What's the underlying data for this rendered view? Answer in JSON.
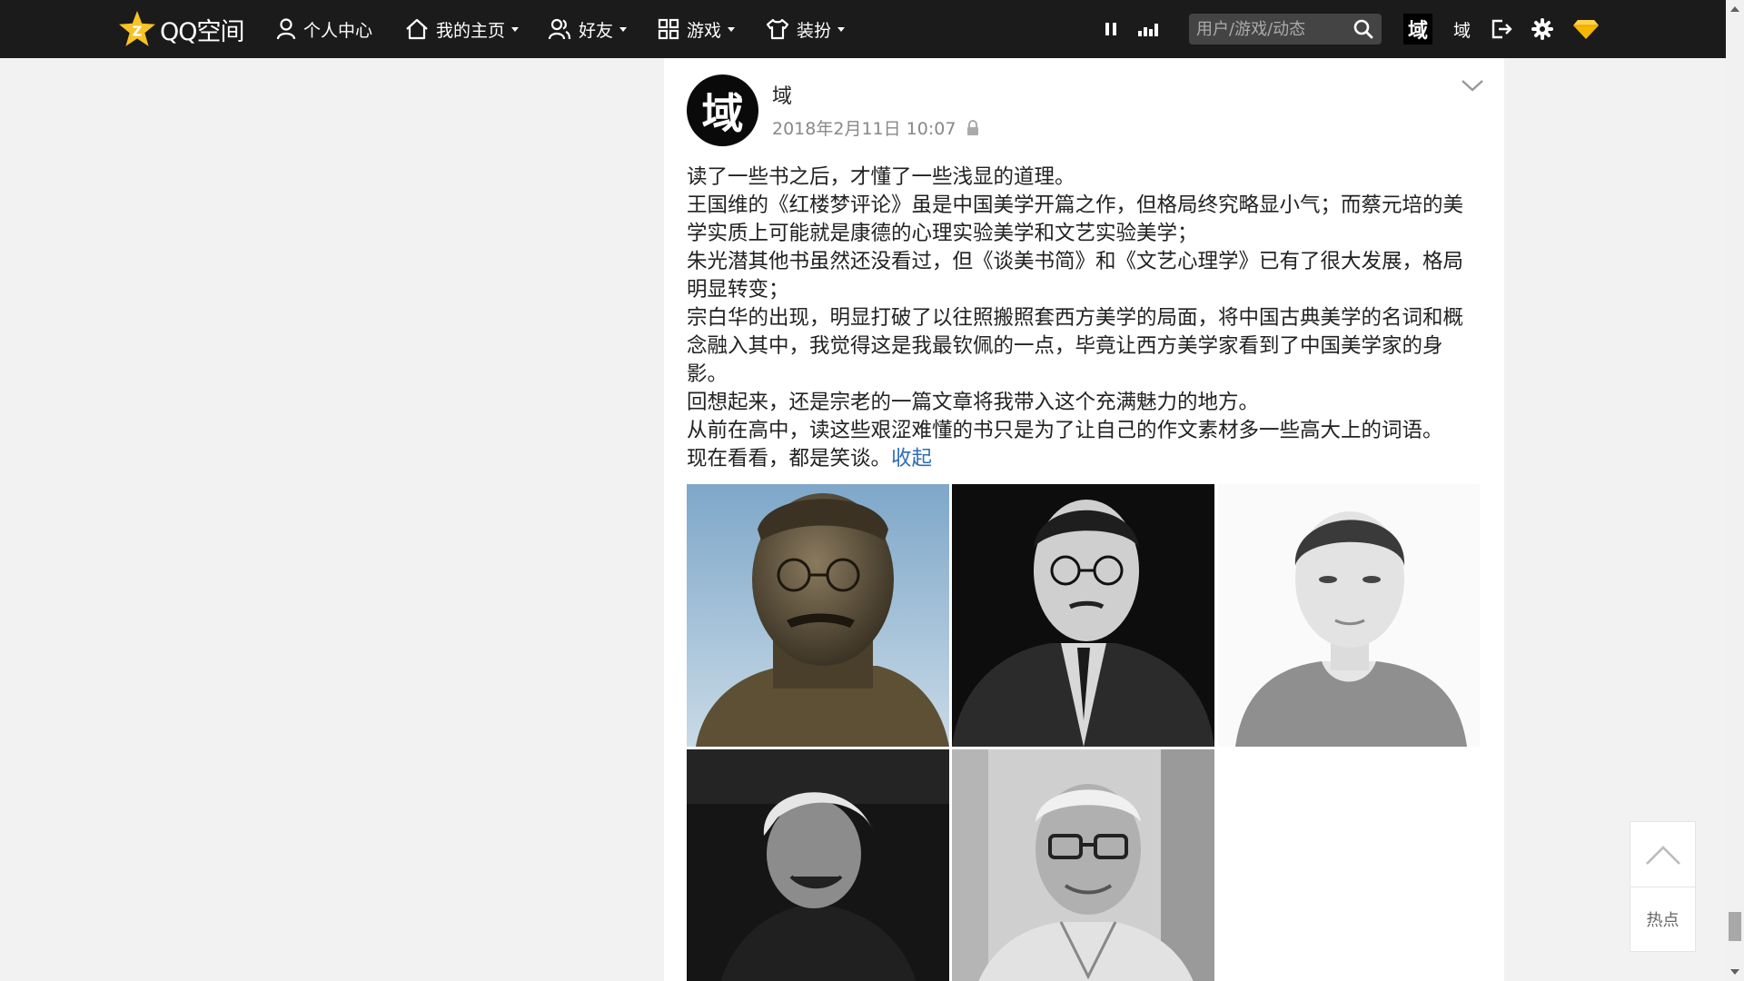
{
  "nav": {
    "logo_text": "QQ空间",
    "items": [
      {
        "label": "个人中心"
      },
      {
        "label": "我的主页"
      },
      {
        "label": "好友"
      },
      {
        "label": "游戏"
      },
      {
        "label": "装扮"
      }
    ],
    "search_placeholder": "用户/游戏/动态",
    "avatar_char": "域",
    "user_name": "域",
    "icons": [
      "qq-star-logo-icon",
      "user-icon",
      "home-icon",
      "friends-icon",
      "grid-icon",
      "shirt-icon",
      "pause-icon",
      "signal-bars-icon",
      "search-icon",
      "logout-icon",
      "gear-icon",
      "diamond-icon"
    ]
  },
  "post": {
    "avatar_char": "域",
    "author": "域",
    "time": "2018年2月11日 10:07",
    "paragraphs": [
      "读了一些书之后，才懂了一些浅显的道理。",
      "王国维的《红楼梦评论》虽是中国美学开篇之作，但格局终究略显小气；而蔡元培的美学实质上可能就是康德的心理实验美学和文艺实验美学；",
      "朱光潜其他书虽然还没看过，但《谈美书简》和《文艺心理学》已有了很大发展，格局明显转变；",
      "宗白华的出现，明显打破了以往照搬照套西方美学的局面，将中国古典美学的名词和概念融入其中，我觉得这是我最钦佩的一点，毕竟让西方美学家看到了中国美学家的身影。",
      "回想起来，还是宗老的一篇文章将我带入这个充满魅力的地方。",
      "从前在高中，读这些艰涩难懂的书只是为了让自己的作文素材多一些高大上的词语。"
    ],
    "last_line": "现在看看，都是笑谈。",
    "collapse_label": "收起",
    "photos": [
      {
        "name": "bronze-bust-photo"
      },
      {
        "name": "man-with-glasses-bw-photo"
      },
      {
        "name": "young-man-portrait-photo"
      },
      {
        "name": "elderly-man-laughing-photo"
      },
      {
        "name": "elderly-man-glasses-photo"
      }
    ]
  },
  "side": {
    "hot_label": "热点"
  },
  "colors": {
    "nav_bg": "#1b1b1b",
    "page_bg": "#f2f2f2",
    "link": "#2e6db5",
    "logo_star": "#f7c326",
    "diamond": "#f5b700"
  }
}
